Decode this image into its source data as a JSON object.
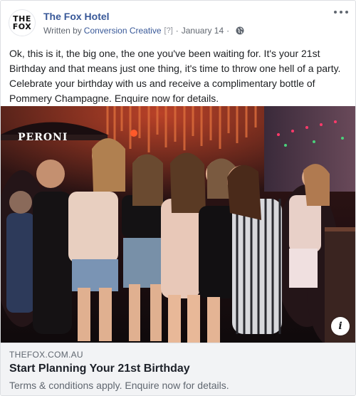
{
  "post": {
    "page_name": "The Fox Hotel",
    "logo_line1": "THE",
    "logo_line2": "FOX",
    "written_by_label": "Written by",
    "author": "Conversion Creative",
    "author_help": "[?]",
    "separator": "·",
    "date": "January 14",
    "audience_icon": "globe-icon",
    "more_icon": "more-options-icon",
    "text": "Ok, this is it, the big one, the one you've been waiting for. It's your 21st Birthday and that means just one thing, it's time to throw one hell of a party. Celebrate your birthday with us and receive a complimentary bottle of Pommery Champagne. Enquire now for details."
  },
  "image": {
    "alt_sign": "PERONI",
    "info_label": "i"
  },
  "link": {
    "domain": "THEFOX.COM.AU",
    "title": "Start Planning Your 21st Birthday",
    "description": "Terms & conditions apply. Enquire now for details."
  },
  "colors": {
    "link_blue": "#385898",
    "meta_gray": "#616770",
    "footer_bg": "#f2f3f5"
  }
}
